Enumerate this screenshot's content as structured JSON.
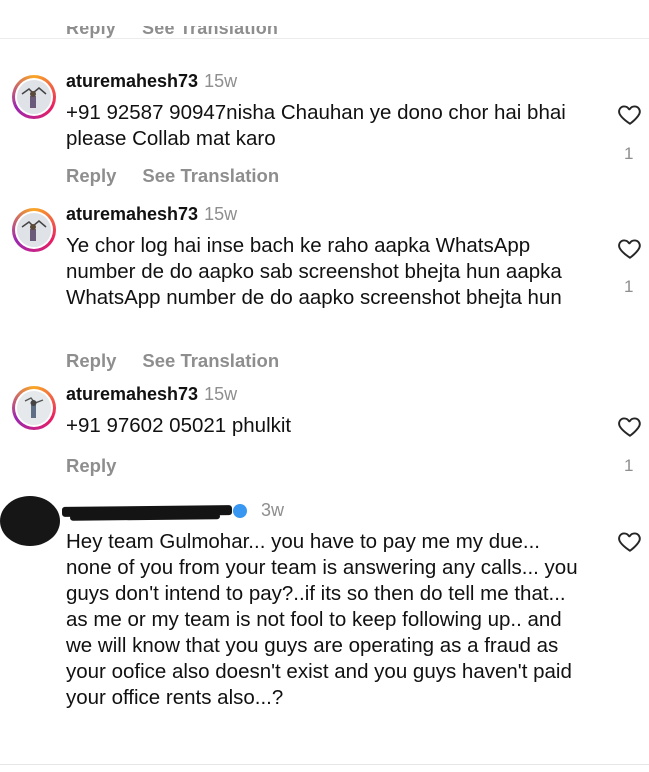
{
  "top_partial": {
    "reply": "Reply",
    "see_translation": "See Translation"
  },
  "comments": [
    {
      "username": "aturemahesh73",
      "time": "15w",
      "text": "+91 92587 90947nisha Chauhan ye dono chor hai bhai please Collab mat karo",
      "reply": "Reply",
      "see_translation": "See Translation",
      "likes": "1"
    },
    {
      "username": "aturemahesh73",
      "time": "15w",
      "text": "Ye chor log hai inse bach ke raho aapka WhatsApp number de do aapko sab screenshot bhejta hun aapka WhatsApp number de do aapko screenshot bhejta hun",
      "reply": "Reply",
      "see_translation": "See Translation",
      "likes": "1"
    },
    {
      "username": "aturemahesh73",
      "time": "15w",
      "text": "+91 97602 05021 phulkit",
      "reply": "Reply",
      "likes": "1"
    },
    {
      "time": "3w",
      "text": "Hey team Gulmohar... you have to pay me my due... none of you from your team is answering any calls... you guys don't intend to pay?..if its so then do tell me that... as me or my team is not fool to keep following up.. and we will know that you guys are operating as a fraud as your oofice also doesn't exist and you guys haven't paid your office rents also...?"
    }
  ],
  "icons": {
    "like": "heart-outline-icon",
    "verified": "verified-badge-icon"
  },
  "colors": {
    "muted": "#8e8e8e",
    "verified": "#3897f0"
  }
}
